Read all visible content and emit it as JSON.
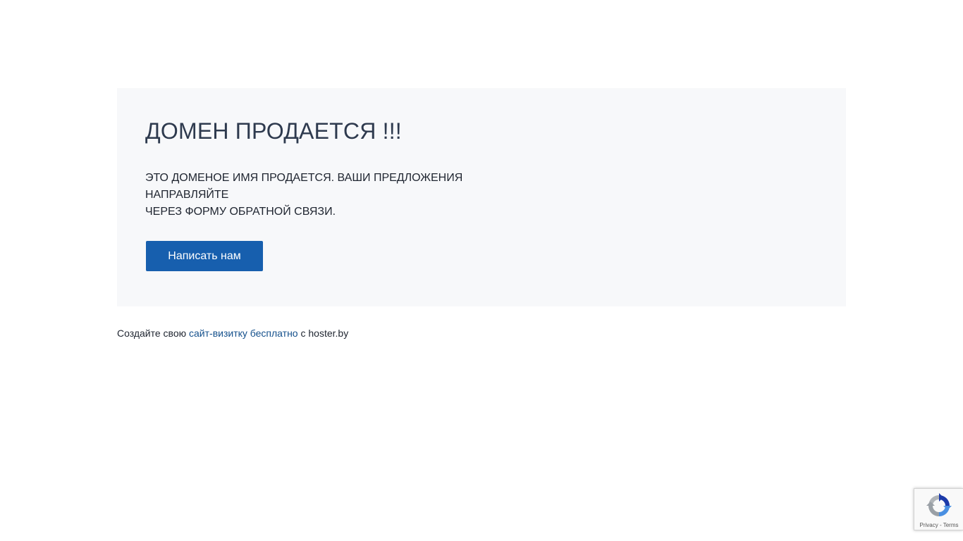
{
  "hero": {
    "title": "ДОМЕН ПРОДАЕТСЯ !!!",
    "description_line1": "ЭТО ДОМЕНОЕ ИМЯ ПРОДАЕТСЯ. ВАШИ ПРЕДЛОЖЕНИЯ НАПРАВЛЯЙТЕ",
    "description_line2": "ЧЕРЕЗ ФОРМУ ОБРАТНОЙ СВЯЗИ.",
    "button_label": "Написать нам"
  },
  "footer": {
    "prefix": "Создайте свою",
    "link_text": "сайт-визитку бесплатно",
    "suffix": "с hoster.by"
  },
  "recaptcha": {
    "privacy": "Privacy",
    "separator": "-",
    "terms": "Terms",
    "icon": "recaptcha-icon"
  },
  "colors": {
    "accent": "#175fae",
    "hero_background": "#f7f8fa",
    "link": "#14508c",
    "title": "#2e3a4e"
  }
}
